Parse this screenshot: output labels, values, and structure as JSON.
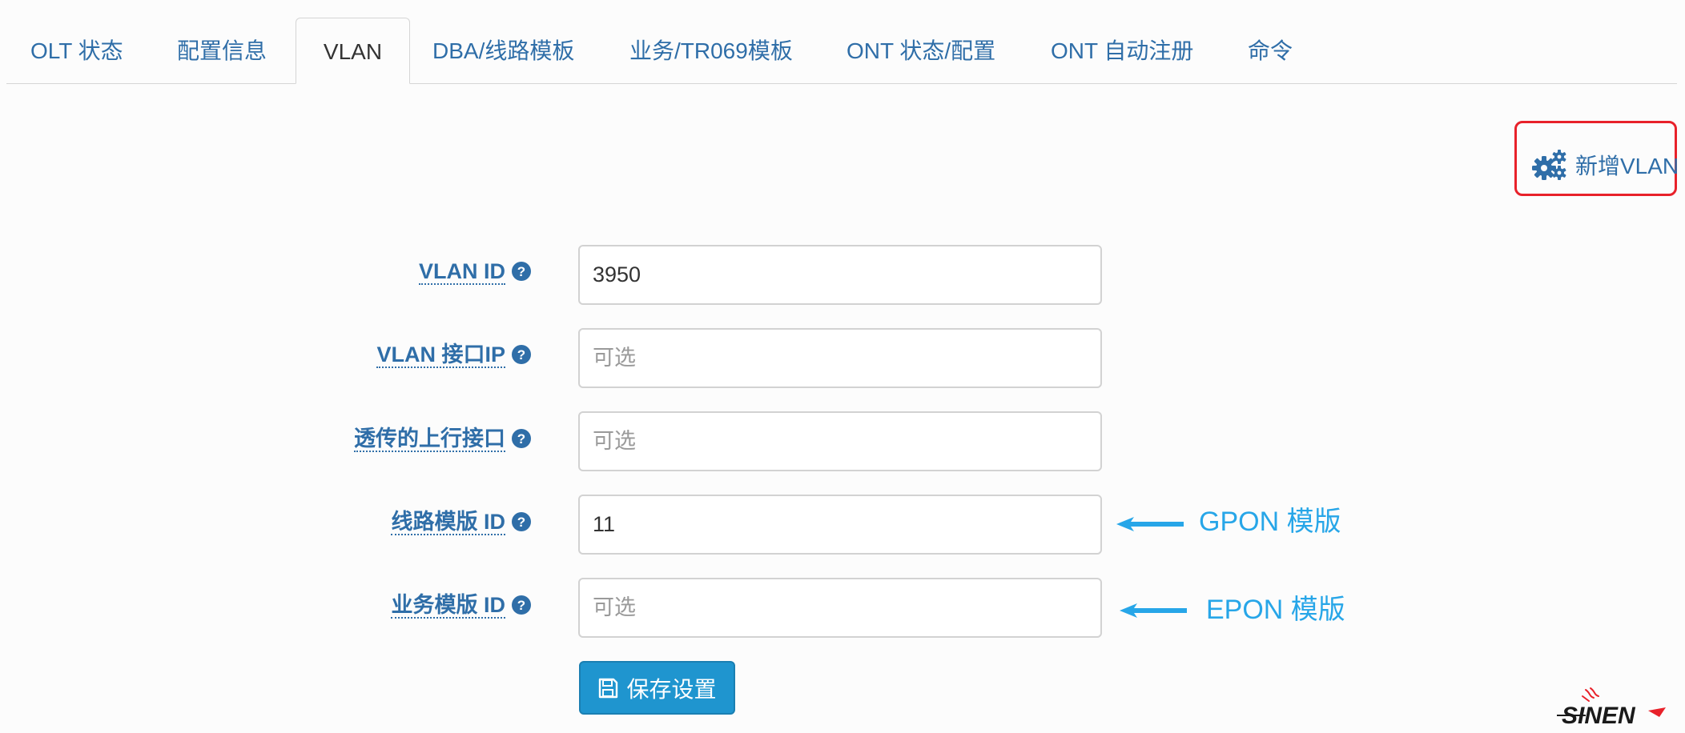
{
  "tabs": [
    {
      "label": "OLT 状态",
      "active": false
    },
    {
      "label": "配置信息",
      "active": false
    },
    {
      "label": "VLAN",
      "active": true
    },
    {
      "label": "DBA/线路模板",
      "active": false
    },
    {
      "label": "业务/TR069模板",
      "active": false
    },
    {
      "label": "ONT 状态/配置",
      "active": false
    },
    {
      "label": "ONT 自动注册",
      "active": false
    },
    {
      "label": "命令",
      "active": false
    }
  ],
  "toolbar": {
    "add_vlan_label": "新增VLAN",
    "add_vlan_icon": "gears-icon"
  },
  "form": {
    "vlan_id": {
      "label": "VLAN ID",
      "value": "3950",
      "placeholder": ""
    },
    "vlan_interface_ip": {
      "label": "VLAN 接口IP",
      "value": "",
      "placeholder": "可选"
    },
    "uplink_interface": {
      "label": "透传的上行接口",
      "value": "",
      "placeholder": "可选"
    },
    "line_profile_id": {
      "label": "线路模版 ID",
      "value": "11",
      "placeholder": ""
    },
    "service_profile_id": {
      "label": "业务模版 ID",
      "value": "",
      "placeholder": "可选"
    },
    "save_label": "保存设置",
    "help_icon": "question-circle-icon"
  },
  "annotations": {
    "gpon": "GPON 模版",
    "epon": "EPON 模版"
  },
  "colors": {
    "link": "#2f6ea8",
    "primary_button": "#1f95cf",
    "highlight_box": "#e8212a",
    "annotation": "#27a6e8"
  }
}
